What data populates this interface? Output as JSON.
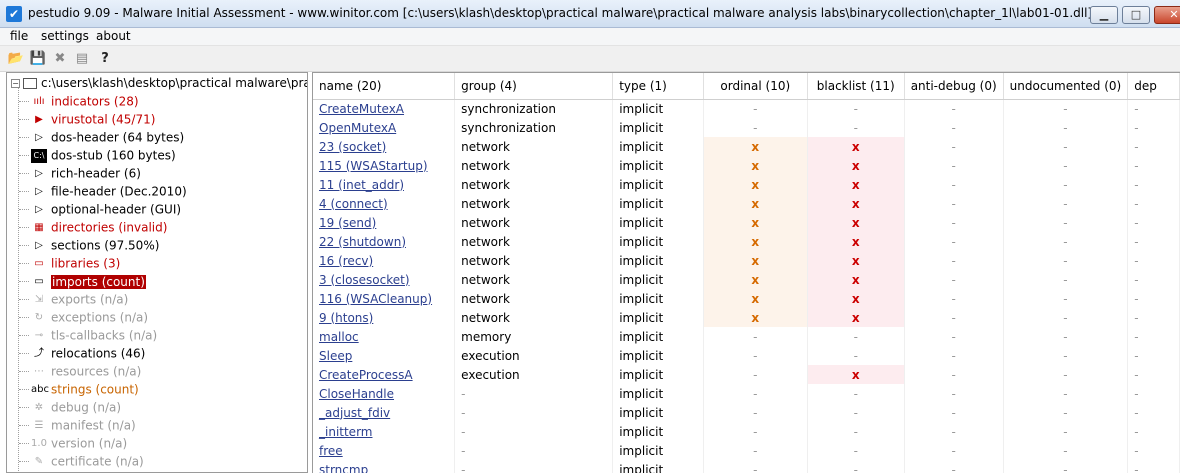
{
  "window": {
    "title": "pestudio 9.09 - Malware Initial Assessment - www.winitor.com [c:\\users\\klash\\desktop\\practical malware\\practical malware analysis labs\\binarycollection\\chapter_1l\\lab01-01.dll]",
    "app_icon_glyph": "✔",
    "minimize_glyph": "▁",
    "maximize_glyph": "□",
    "close_glyph": "✕"
  },
  "menu": [
    "file",
    "settings",
    "about"
  ],
  "toolbar": {
    "icons": [
      "open-icon",
      "save-icon",
      "delete-icon",
      "clipboard-icon",
      "help-icon"
    ],
    "glyphs": [
      "📂",
      "💾",
      "✖",
      "▤",
      "?"
    ]
  },
  "tree": {
    "root_label": "c:\\users\\klash\\desktop\\practical malware\\practic",
    "expander": "−",
    "items": [
      {
        "label": "indicators (28)",
        "color": "red",
        "icon": "indicators-icon",
        "glyph": "ıılı"
      },
      {
        "label": "virustotal (45/71)",
        "color": "red",
        "icon": "virustotal-icon",
        "glyph": "▶"
      },
      {
        "label": "dos-header (64 bytes)",
        "color": "black",
        "icon": "chevron-right-icon",
        "glyph": "▷"
      },
      {
        "label": "dos-stub (160 bytes)",
        "color": "black",
        "icon": "console-icon",
        "glyph": "C:\\"
      },
      {
        "label": "rich-header (6)",
        "color": "black",
        "icon": "chevron-right-icon",
        "glyph": "▷"
      },
      {
        "label": "file-header (Dec.2010)",
        "color": "black",
        "icon": "chevron-right-icon",
        "glyph": "▷"
      },
      {
        "label": "optional-header (GUI)",
        "color": "black",
        "icon": "chevron-right-icon",
        "glyph": "▷"
      },
      {
        "label": "directories (invalid)",
        "color": "red",
        "icon": "directories-icon",
        "glyph": "▦"
      },
      {
        "label": "sections (97.50%)",
        "color": "black",
        "icon": "chevron-right-icon",
        "glyph": "▷"
      },
      {
        "label": "libraries (3)",
        "color": "red",
        "icon": "libraries-icon",
        "glyph": "▭"
      },
      {
        "label": "imports (count)",
        "color": "selected",
        "icon": "imports-icon",
        "glyph": "▭"
      },
      {
        "label": "exports (n/a)",
        "color": "grey",
        "icon": "exports-icon",
        "glyph": "⇲"
      },
      {
        "label": "exceptions (n/a)",
        "color": "grey",
        "icon": "exceptions-icon",
        "glyph": "↻"
      },
      {
        "label": "tls-callbacks (n/a)",
        "color": "grey",
        "icon": "tls-callbacks-icon",
        "glyph": "⊸"
      },
      {
        "label": "relocations (46)",
        "color": "black",
        "icon": "relocations-icon",
        "glyph": "⤴"
      },
      {
        "label": "resources (n/a)",
        "color": "grey",
        "icon": "resources-icon",
        "glyph": "⋯"
      },
      {
        "label": "strings (count)",
        "color": "orange",
        "icon": "strings-icon",
        "glyph": "abc"
      },
      {
        "label": "debug (n/a)",
        "color": "grey",
        "icon": "debug-icon",
        "glyph": "✲"
      },
      {
        "label": "manifest (n/a)",
        "color": "grey",
        "icon": "manifest-icon",
        "glyph": "☰"
      },
      {
        "label": "version (n/a)",
        "color": "grey",
        "icon": "version-icon",
        "glyph": "1.0"
      },
      {
        "label": "certificate (n/a)",
        "color": "grey",
        "icon": "certificate-icon",
        "glyph": "✎"
      }
    ]
  },
  "table": {
    "columns": [
      "name (20)",
      "group (4)",
      "type (1)",
      "ordinal (10)",
      "blacklist (11)",
      "anti-debug (0)",
      "undocumented (0)",
      "dep"
    ],
    "rows": [
      {
        "name": "CreateMutexA",
        "group": "synchronization",
        "type": "implicit",
        "ordinal": "-",
        "blacklist": "-",
        "anti_debug": "-",
        "undocumented": "-",
        "dep": "-"
      },
      {
        "name": "OpenMutexA",
        "group": "synchronization",
        "type": "implicit",
        "ordinal": "-",
        "blacklist": "-",
        "anti_debug": "-",
        "undocumented": "-",
        "dep": "-"
      },
      {
        "name": "23 (socket)",
        "group": "network",
        "type": "implicit",
        "ordinal": "x",
        "blacklist": "x",
        "anti_debug": "-",
        "undocumented": "-",
        "dep": "-"
      },
      {
        "name": "115 (WSAStartup)",
        "group": "network",
        "type": "implicit",
        "ordinal": "x",
        "blacklist": "x",
        "anti_debug": "-",
        "undocumented": "-",
        "dep": "-"
      },
      {
        "name": "11 (inet_addr)",
        "group": "network",
        "type": "implicit",
        "ordinal": "x",
        "blacklist": "x",
        "anti_debug": "-",
        "undocumented": "-",
        "dep": "-"
      },
      {
        "name": "4 (connect)",
        "group": "network",
        "type": "implicit",
        "ordinal": "x",
        "blacklist": "x",
        "anti_debug": "-",
        "undocumented": "-",
        "dep": "-"
      },
      {
        "name": "19 (send)",
        "group": "network",
        "type": "implicit",
        "ordinal": "x",
        "blacklist": "x",
        "anti_debug": "-",
        "undocumented": "-",
        "dep": "-"
      },
      {
        "name": "22 (shutdown)",
        "group": "network",
        "type": "implicit",
        "ordinal": "x",
        "blacklist": "x",
        "anti_debug": "-",
        "undocumented": "-",
        "dep": "-"
      },
      {
        "name": "16 (recv)",
        "group": "network",
        "type": "implicit",
        "ordinal": "x",
        "blacklist": "x",
        "anti_debug": "-",
        "undocumented": "-",
        "dep": "-"
      },
      {
        "name": "3 (closesocket)",
        "group": "network",
        "type": "implicit",
        "ordinal": "x",
        "blacklist": "x",
        "anti_debug": "-",
        "undocumented": "-",
        "dep": "-"
      },
      {
        "name": "116 (WSACleanup)",
        "group": "network",
        "type": "implicit",
        "ordinal": "x",
        "blacklist": "x",
        "anti_debug": "-",
        "undocumented": "-",
        "dep": "-"
      },
      {
        "name": "9 (htons)",
        "group": "network",
        "type": "implicit",
        "ordinal": "x",
        "blacklist": "x",
        "anti_debug": "-",
        "undocumented": "-",
        "dep": "-"
      },
      {
        "name": "malloc",
        "group": "memory",
        "type": "implicit",
        "ordinal": "-",
        "blacklist": "-",
        "anti_debug": "-",
        "undocumented": "-",
        "dep": "-"
      },
      {
        "name": "Sleep",
        "group": "execution",
        "type": "implicit",
        "ordinal": "-",
        "blacklist": "-",
        "anti_debug": "-",
        "undocumented": "-",
        "dep": "-"
      },
      {
        "name": "CreateProcessA",
        "group": "execution",
        "type": "implicit",
        "ordinal": "-",
        "blacklist": "x",
        "anti_debug": "-",
        "undocumented": "-",
        "dep": "-"
      },
      {
        "name": "CloseHandle",
        "group": "-",
        "type": "implicit",
        "ordinal": "-",
        "blacklist": "-",
        "anti_debug": "-",
        "undocumented": "-",
        "dep": "-"
      },
      {
        "name": "_adjust_fdiv",
        "group": "-",
        "type": "implicit",
        "ordinal": "-",
        "blacklist": "-",
        "anti_debug": "-",
        "undocumented": "-",
        "dep": "-"
      },
      {
        "name": "_initterm",
        "group": "-",
        "type": "implicit",
        "ordinal": "-",
        "blacklist": "-",
        "anti_debug": "-",
        "undocumented": "-",
        "dep": "-"
      },
      {
        "name": "free",
        "group": "-",
        "type": "implicit",
        "ordinal": "-",
        "blacklist": "-",
        "anti_debug": "-",
        "undocumented": "-",
        "dep": "-"
      },
      {
        "name": "strncmp",
        "group": "-",
        "type": "implicit",
        "ordinal": "-",
        "blacklist": "-",
        "anti_debug": "-",
        "undocumented": "-",
        "dep": "-"
      }
    ]
  },
  "colors": {
    "flag_red": "#cc0000",
    "flag_orange": "#d66a00",
    "selection": "#b00000",
    "link": "#2b3f8f"
  }
}
